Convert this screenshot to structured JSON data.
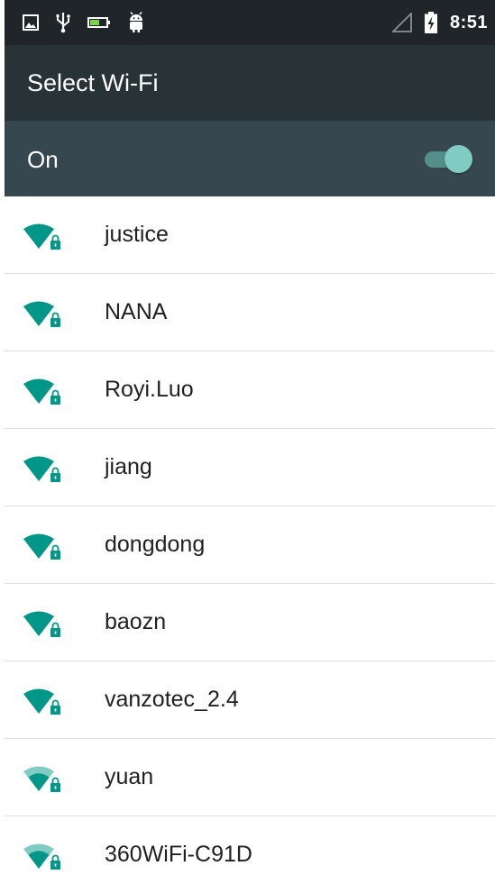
{
  "status_bar": {
    "time": "8:51",
    "left_icons": [
      "image-icon",
      "usb-icon",
      "battery-saver-icon",
      "android-debug-icon"
    ],
    "right_icons": [
      "cell-signal-icon",
      "battery-charging-icon"
    ]
  },
  "app_bar": {
    "title": "Select Wi-Fi"
  },
  "wifi_switch": {
    "label": "On",
    "enabled": true
  },
  "networks": [
    {
      "name": "justice",
      "signal": "strong",
      "secured": true
    },
    {
      "name": "NANA",
      "signal": "strong",
      "secured": true
    },
    {
      "name": "Royi.Luo",
      "signal": "strong",
      "secured": true
    },
    {
      "name": "jiang",
      "signal": "strong",
      "secured": true
    },
    {
      "name": "dongdong",
      "signal": "strong",
      "secured": true
    },
    {
      "name": "baozn",
      "signal": "strong",
      "secured": true
    },
    {
      "name": "vanzotec_2.4",
      "signal": "strong",
      "secured": true
    },
    {
      "name": "yuan",
      "signal": "medium",
      "secured": true
    },
    {
      "name": "360WiFi-C91D",
      "signal": "medium",
      "secured": true
    }
  ],
  "colors": {
    "status_bar": "#1f2528",
    "app_bar": "#283337",
    "switch_bar": "#37474f",
    "accent": "#009688",
    "toggle_thumb": "#80cbc4"
  }
}
